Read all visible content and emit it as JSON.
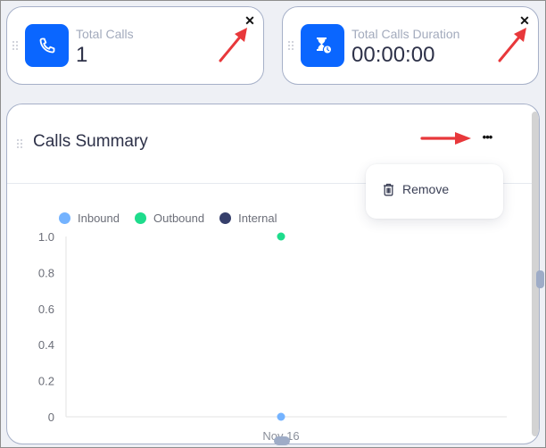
{
  "stat_cards": [
    {
      "label": "Total Calls",
      "value": "1",
      "icon": "phone-icon",
      "close_label": "✕"
    },
    {
      "label": "Total Calls Duration",
      "value": "00:00:00",
      "icon": "hourglass-clock-icon",
      "close_label": "✕"
    }
  ],
  "summary": {
    "title": "Calls Summary",
    "more_label": "•••",
    "menu": {
      "items": [
        {
          "label": "Remove",
          "icon": "trash-icon"
        }
      ]
    }
  },
  "colors": {
    "accent": "#0a66ff",
    "inbound": "#74b3ff",
    "outbound": "#1edc8c",
    "internal": "#363f6b",
    "annotation_arrow": "#e8383b"
  },
  "chart_data": {
    "type": "scatter",
    "title": "",
    "xlabel": "",
    "ylabel": "",
    "categories": [
      "Nov 16"
    ],
    "ylim": [
      0,
      1.0
    ],
    "yticks": [
      "0",
      "0.2",
      "0.4",
      "0.6",
      "0.8",
      "1.0"
    ],
    "legend_position": "top-left",
    "series": [
      {
        "name": "Inbound",
        "values": [
          0
        ]
      },
      {
        "name": "Outbound",
        "values": [
          1
        ]
      },
      {
        "name": "Internal",
        "values": [
          null
        ]
      }
    ]
  }
}
